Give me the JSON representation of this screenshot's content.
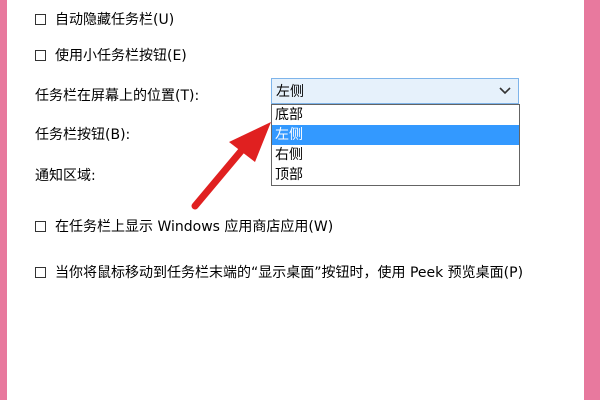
{
  "colors": {
    "frame": "#e8799e",
    "dropdown_bg": "#e6f1fb",
    "selection": "#3399ff",
    "arrow": "#e02020"
  },
  "checkboxes": {
    "autohide": "自动隐藏任务栏(U)",
    "small_buttons": "使用小任务栏按钮(E)",
    "store_apps": "在任务栏上显示 Windows 应用商店应用(W)",
    "peek": "当你将鼠标移动到任务栏末端的“显示桌面”按钮时，使用 Peek 预览桌面(P)"
  },
  "labels": {
    "position": "任务栏在屏幕上的位置(T):",
    "buttons": "任务栏按钮(B):",
    "notification": "通知区域:"
  },
  "position_select": {
    "selected": "左侧",
    "options": [
      "底部",
      "左侧",
      "右侧",
      "顶部"
    ],
    "highlighted_index": 1,
    "chevron_icon": "chevron-down-icon"
  },
  "annotation_icon": "red-arrow-icon"
}
